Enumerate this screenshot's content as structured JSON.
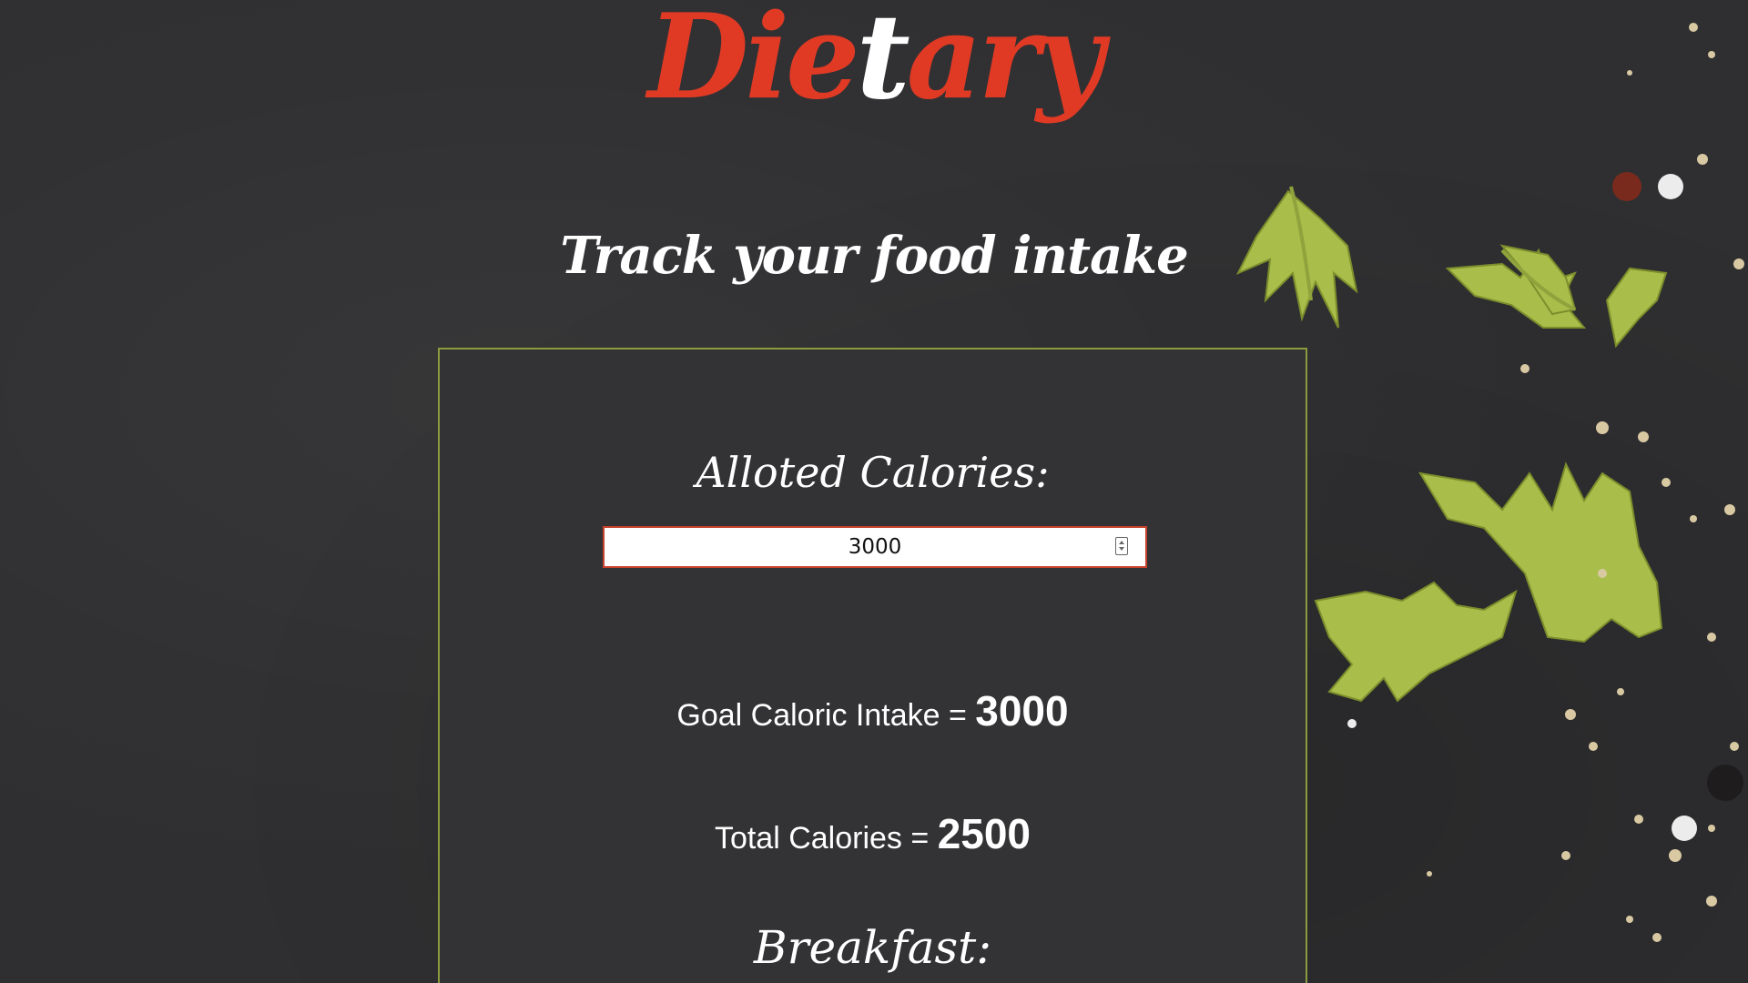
{
  "header": {
    "logo_part1": "Die",
    "logo_part2": "t",
    "logo_part3": "ary",
    "tagline": "Track your food intake"
  },
  "calories_form": {
    "alloted_label": "Alloted Calories:",
    "alloted_value": "3000",
    "goal_label": "Goal Caloric Intake = ",
    "goal_value": "3000",
    "total_label": "Total Calories = ",
    "total_value": "2500"
  },
  "meals": {
    "breakfast_label": "Breakfast:"
  },
  "colors": {
    "accent_red": "#e03a25",
    "panel_border": "#8d9a3d",
    "panel_bg": "#333335",
    "page_bg": "#2f2f31",
    "input_border": "#c7412c"
  }
}
